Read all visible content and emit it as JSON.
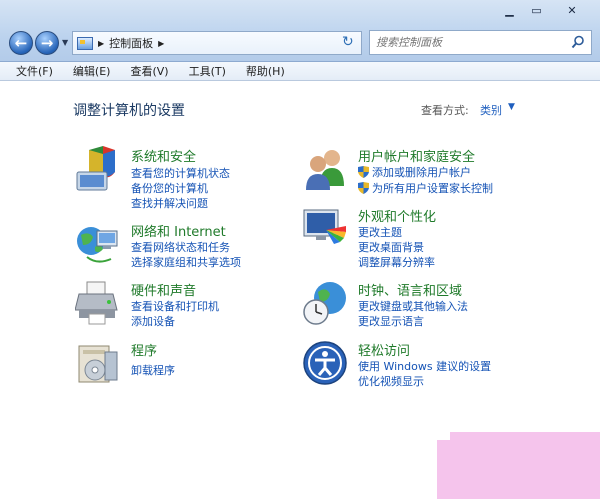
{
  "window": {
    "minimize": "▁",
    "maximize": "▭",
    "close": "✕"
  },
  "address": {
    "path": "控制面板"
  },
  "search": {
    "placeholder": "搜索控制面板"
  },
  "menu": {
    "items": [
      "文件(F)",
      "编辑(E)",
      "查看(V)",
      "工具(T)",
      "帮助(H)"
    ]
  },
  "content": {
    "title": "调整计算机的设置",
    "view_label": "查看方式:",
    "view_value": "类别"
  },
  "categories": [
    {
      "title": "系统和安全",
      "icon": "shield-security-icon",
      "links": [
        "查看您的计算机状态",
        "备份您的计算机",
        "查找并解决问题"
      ]
    },
    {
      "title": "网络和 Internet",
      "icon": "network-globe-icon",
      "links": [
        "查看网络状态和任务",
        "选择家庭组和共享选项"
      ]
    },
    {
      "title": "硬件和声音",
      "icon": "printer-icon",
      "links": [
        "查看设备和打印机",
        "添加设备"
      ]
    },
    {
      "title": "程序",
      "icon": "programs-icon",
      "links": [
        "卸载程序"
      ]
    },
    {
      "title": "用户帐户和家庭安全",
      "icon": "users-icon",
      "links": [
        "添加或删除用户帐户",
        "为所有用户设置家长控制"
      ]
    },
    {
      "title": "外观和个性化",
      "icon": "appearance-icon",
      "links": [
        "更改主题",
        "更改桌面背景",
        "调整屏幕分辨率"
      ]
    },
    {
      "title": "时钟、语言和区域",
      "icon": "clock-globe-icon",
      "links": [
        "更改键盘或其他输入法",
        "更改显示语言"
      ]
    },
    {
      "title": "轻松访问",
      "icon": "ease-of-access-icon",
      "links": [
        "使用 Windows 建议的设置",
        "优化视频显示"
      ]
    }
  ],
  "colors": {
    "category_title": "#1f7a2a",
    "link": "#1553b5",
    "accent_pink": "#f5c4ec"
  }
}
